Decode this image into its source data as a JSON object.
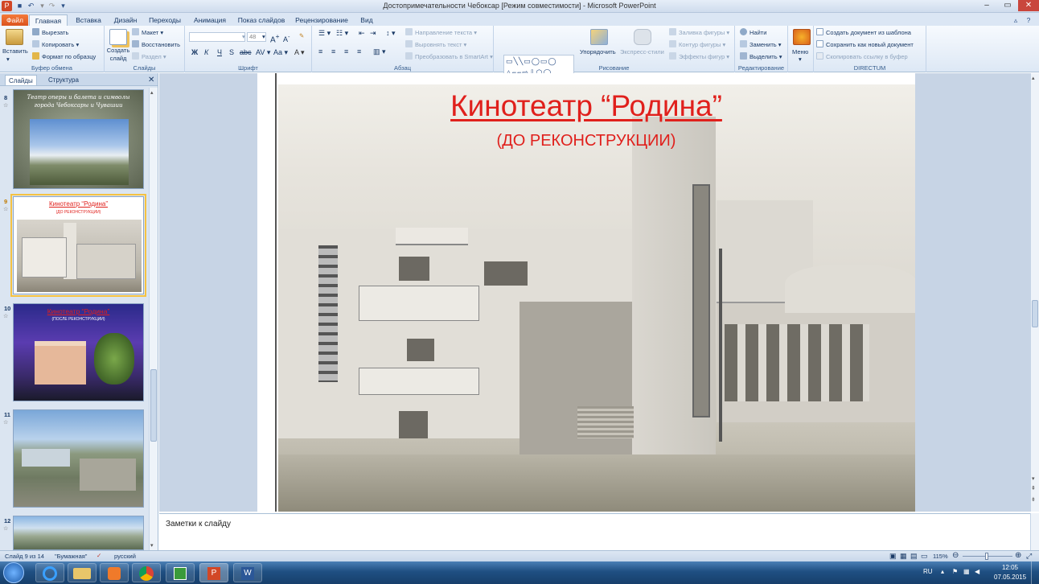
{
  "window": {
    "title": "Достопримечательности Чебоксар [Режим совместимости] - Microsoft PowerPoint"
  },
  "tabs": [
    "Файл",
    "Главная",
    "Вставка",
    "Дизайн",
    "Переходы",
    "Анимация",
    "Показ слайдов",
    "Рецензирование",
    "Вид"
  ],
  "ribbon": {
    "clipboard": {
      "paste": "Вставить",
      "cut": "Вырезать",
      "copy": "Копировать",
      "format": "Формат по образцу",
      "label": "Буфер обмена"
    },
    "slides": {
      "new_slide": "Создать слайд",
      "layout": "Макет",
      "reset": "Восстановить",
      "section": "Раздел",
      "label": "Слайды"
    },
    "font": {
      "size": "48",
      "label": "Шрифт"
    },
    "paragraph": {
      "text_direction": "Направление текста",
      "align_text": "Выровнять текст",
      "smartart": "Преобразовать в SmartArt",
      "label": "Абзац"
    },
    "drawing": {
      "arrange": "Упорядочить",
      "quick_styles": "Экспресс-стили",
      "fill": "Заливка фигуры",
      "outline": "Контур фигуры",
      "effects": "Эффекты фигур",
      "label": "Рисование"
    },
    "editing": {
      "find": "Найти",
      "replace": "Заменить",
      "select": "Выделить",
      "label": "Редактирование"
    },
    "menu": {
      "label": "Меню"
    },
    "directum": {
      "create_from_template": "Создать документ из шаблона",
      "save_new": "Сохранить как новый документ",
      "copy_link": "Скопировать ссылку в буфер",
      "label": "DIRECTUM"
    }
  },
  "pane": {
    "tabs": [
      "Слайды",
      "Структура"
    ],
    "thumbs": [
      {
        "num": "8",
        "star": "☆",
        "title": "Театр оперы и балета и символы города Чебоксары и Чувашии"
      },
      {
        "num": "9",
        "star": "☆",
        "title": "Кинотеатр “Родина”",
        "subtitle": "(ДО РЕКОНСТРУКЦИИ)"
      },
      {
        "num": "10",
        "star": "☆",
        "title": "Кинотеатр “Родина”",
        "subtitle": "(ПОСЛЕ РЕКОНСТРУКЦИИ)"
      },
      {
        "num": "11",
        "star": "☆"
      },
      {
        "num": "12",
        "star": "☆"
      }
    ]
  },
  "slide": {
    "title": "Кинотеатр “Родина”",
    "subtitle": "(ДО РЕКОНСТРУКЦИИ)"
  },
  "notes": {
    "placeholder": "Заметки к слайду"
  },
  "statusbar": {
    "slide_info": "Слайд 9 из 14",
    "theme": "\"Бумажная\"",
    "language": "русский",
    "zoom": "115%"
  },
  "taskbar": {
    "lang": "RU",
    "time": "12:05",
    "date": "07.05.2015"
  },
  "colors": {
    "title_red": "#e0201c",
    "ribbon_blue": "#dbe6f4",
    "file_tab": "#e8622a"
  }
}
